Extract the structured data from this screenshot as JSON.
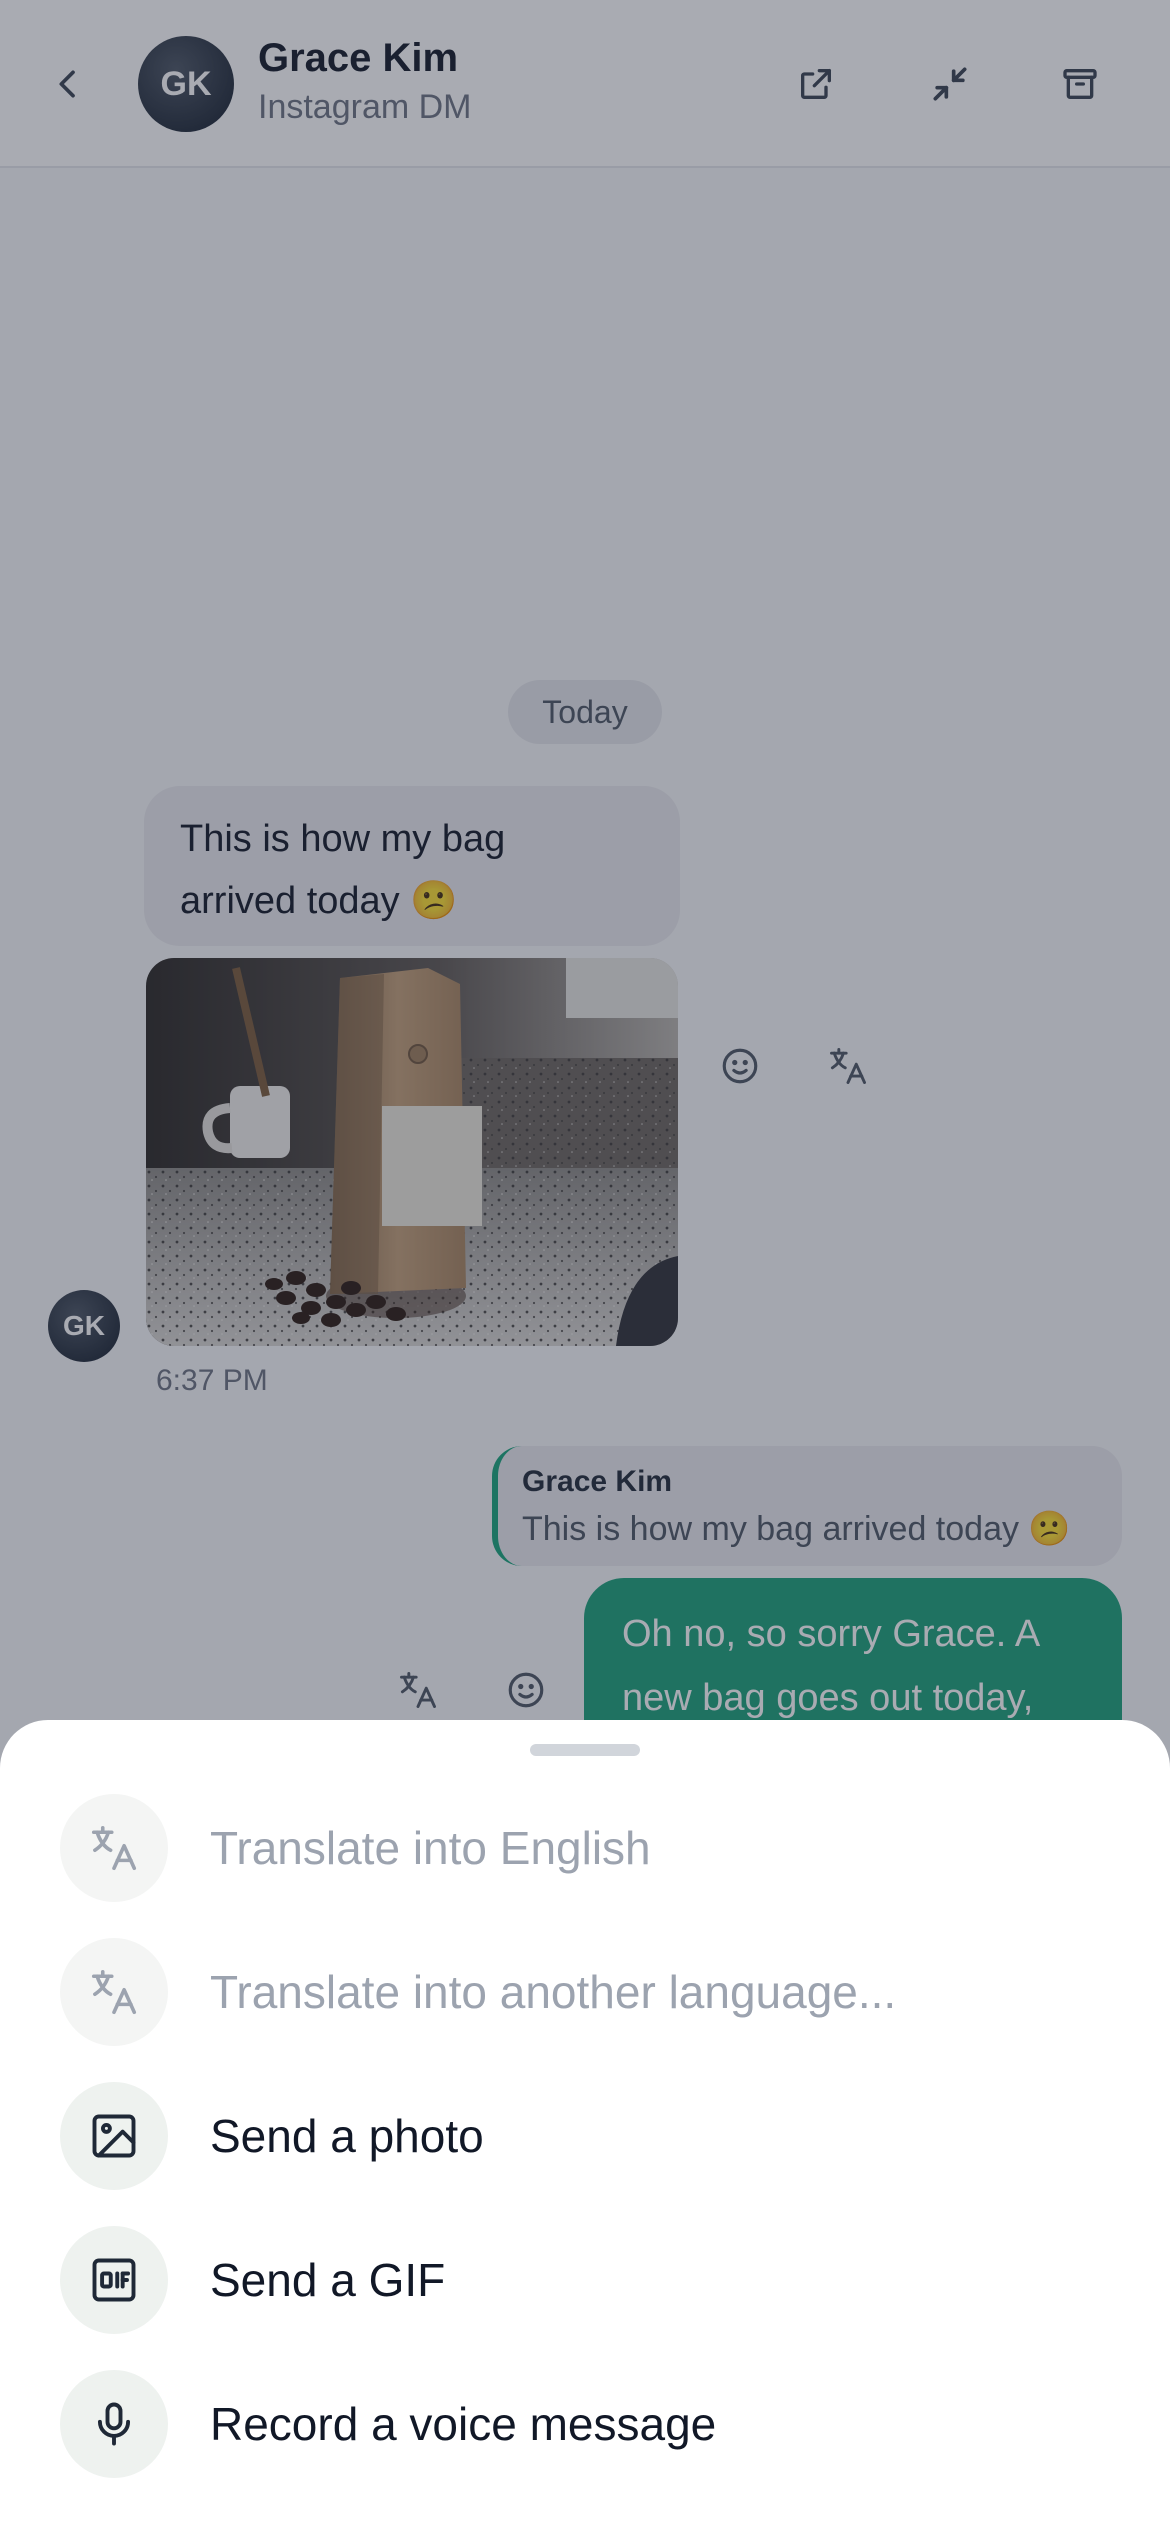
{
  "header": {
    "avatar_initials": "GK",
    "contact_name": "Grace Kim",
    "channel": "Instagram DM",
    "icons": [
      "chevron-left-icon",
      "external-link-icon",
      "minimize-icon",
      "archive-icon"
    ]
  },
  "conversation": {
    "date_divider": "Today",
    "incoming": {
      "avatar_initials": "GK",
      "text_line1": "This is how my bag",
      "text_line2": "arrived today 😕",
      "time": "6:37 PM"
    },
    "reply_quote": {
      "author": "Grace Kim",
      "text": "This is how my bag arrived today 😕"
    },
    "outgoing": {
      "text_line1": "Oh no, so sorry Grace. A",
      "text_line2": "new bag goes out today,"
    }
  },
  "sheet": {
    "options": [
      {
        "label": "Translate into English",
        "icon": "translate-icon",
        "enabled": false
      },
      {
        "label": "Translate into another language...",
        "icon": "translate-icon",
        "enabled": false
      },
      {
        "label": "Send a photo",
        "icon": "image-icon",
        "enabled": true
      },
      {
        "label": "Send a GIF",
        "icon": "gif-icon",
        "enabled": true
      },
      {
        "label": "Record a voice message",
        "icon": "microphone-icon",
        "enabled": true
      }
    ]
  },
  "colors": {
    "accent": "#1aa079",
    "overlay": "#282e3e",
    "avatar": "#1f2937"
  }
}
